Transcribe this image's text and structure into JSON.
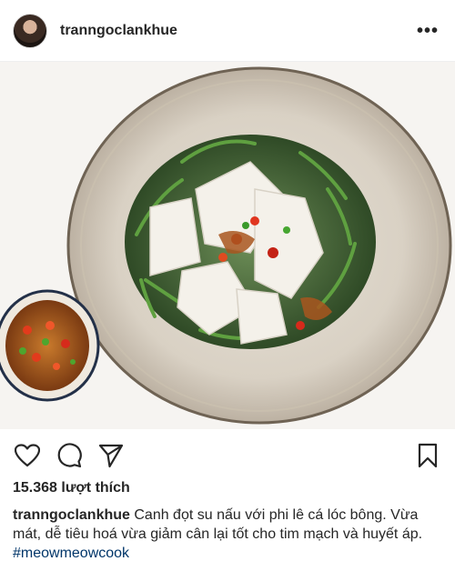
{
  "post": {
    "username": "tranngoclankhue",
    "likes_text": "15.368 lượt thích",
    "caption_text": "Canh đọt su nấu với phi lê cá lóc bông. Vừa mát, dễ tiêu hoá vừa giảm cân lại tốt cho tim mạch và huyết áp.",
    "hashtag": "#meowmeowcook"
  },
  "header": {
    "more_label": "•••"
  },
  "icons": {
    "like": "heart-icon",
    "comment": "comment-icon",
    "share": "share-icon",
    "save": "bookmark-icon",
    "more": "more-icon"
  },
  "colors": {
    "hashtag": "#003569",
    "text": "#262626"
  }
}
